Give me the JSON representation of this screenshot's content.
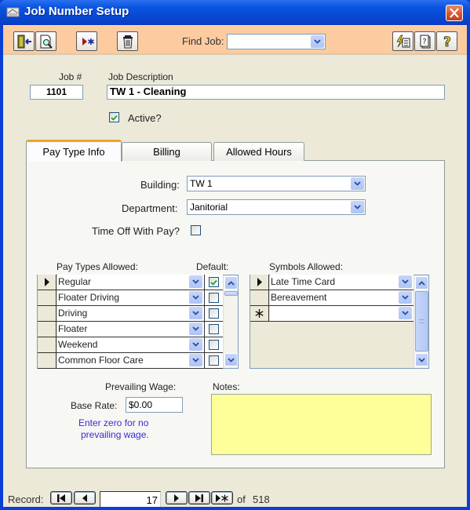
{
  "window": {
    "title": "Job Number Setup",
    "close_icon": "close-x-icon"
  },
  "toolbar": {
    "buttons": [
      {
        "name": "exit-button",
        "icon": "door-exit-icon"
      },
      {
        "name": "print-preview-button",
        "icon": "magnifier-page-icon"
      },
      {
        "name": "new-record-button",
        "icon": "new-record-star-icon"
      },
      {
        "name": "delete-button",
        "icon": "trash-icon"
      }
    ],
    "find_job_label": "Find Job:",
    "find_job_value": "",
    "right_buttons": [
      {
        "name": "quick-edit-button",
        "icon": "lightning-form-icon"
      },
      {
        "name": "form-help-button",
        "icon": "page-question-icon"
      },
      {
        "name": "help-button",
        "icon": "question-mark-icon"
      }
    ]
  },
  "job": {
    "number_label": "Job #",
    "number_value": "1101",
    "description_label": "Job Description",
    "description_value": "TW 1 - Cleaning",
    "active_label": "Active?",
    "active_checked": true
  },
  "tabs": [
    {
      "label": "Pay Type Info",
      "active": true
    },
    {
      "label": "Billing",
      "active": false
    },
    {
      "label": "Allowed Hours",
      "active": false
    }
  ],
  "pay_type_info": {
    "building_label": "Building:",
    "building_value": "TW 1",
    "department_label": "Department:",
    "department_value": "Janitorial",
    "time_off_label": "Time Off With Pay?",
    "time_off_checked": false,
    "pay_types_label": "Pay Types Allowed:",
    "default_label": "Default:",
    "pay_types": [
      {
        "name": "Regular",
        "default": true,
        "current": true
      },
      {
        "name": "Floater Driving",
        "default": false,
        "current": false
      },
      {
        "name": "Driving",
        "default": false,
        "current": false
      },
      {
        "name": "Floater",
        "default": false,
        "current": false
      },
      {
        "name": "Weekend",
        "default": false,
        "current": false
      },
      {
        "name": "Common Floor Care",
        "default": false,
        "current": false
      }
    ],
    "symbols_label": "Symbols Allowed:",
    "symbols": [
      {
        "name": "Late Time Card",
        "current": true
      },
      {
        "name": "Bereavement",
        "current": false
      },
      {
        "name": "",
        "new_row": true
      }
    ],
    "prevailing_wage_label": "Prevailing Wage:",
    "base_rate_label": "Base Rate:",
    "base_rate_value": "$0.00",
    "hint_line1": "Enter zero for no",
    "hint_line2": "prevailing wage.",
    "notes_label": "Notes:",
    "notes_value": ""
  },
  "record_nav": {
    "label": "Record:",
    "current": "17",
    "of_label": "of",
    "total": "518"
  },
  "colors": {
    "titlebar": "#0a54e0",
    "toolbar_bg": "#fccba0",
    "notes_bg": "#ffff99",
    "hint_text": "#3a2ad8",
    "tab_accent": "#f2a02c"
  }
}
